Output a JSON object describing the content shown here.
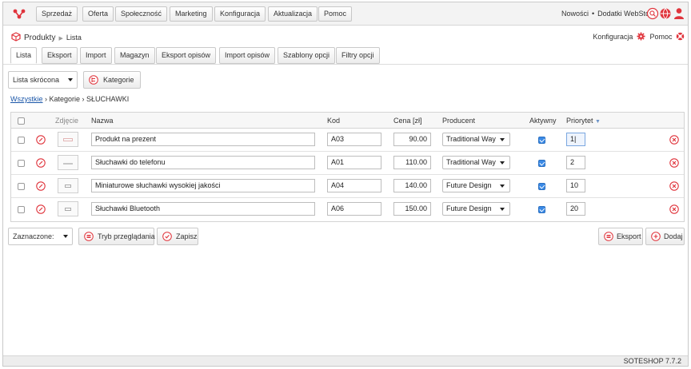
{
  "nav": {
    "buttons": [
      "Sprzedaż",
      "Oferta",
      "Społeczność",
      "Marketing",
      "Konfiguracja",
      "Aktualizacja",
      "Pomoc"
    ],
    "links": [
      "Nowości",
      "Dodatki WebStore"
    ],
    "separator": "•"
  },
  "breadcrumb": {
    "module": "Produkty",
    "page": "Lista"
  },
  "header_actions": {
    "config": "Konfiguracja",
    "help": "Pomoc"
  },
  "tabs": [
    "Lista",
    "Eksport",
    "Import",
    "Magazyn",
    "Eksport opisów",
    "Import opisów",
    "Szablony opcji",
    "Filtry opcji"
  ],
  "view_select": "Lista skrócona",
  "categories_button": "Kategorie",
  "filter": {
    "all_link": "Wszystkie",
    "path": "› Kategorie › SŁUCHAWKI"
  },
  "table": {
    "columns": [
      "Zdjęcie",
      "Nazwa",
      "Kod",
      "Cena [zł]",
      "Producent",
      "Aktywny",
      "Priorytet"
    ],
    "rows": [
      {
        "name": "Produkt na prezent",
        "code": "A03",
        "price": "90.00",
        "producer": "Traditional Way",
        "active": true,
        "priority": "1|"
      },
      {
        "name": "Słuchawki do telefonu",
        "code": "A01",
        "price": "110.00",
        "producer": "Traditional Way",
        "active": true,
        "priority": "2"
      },
      {
        "name": "Miniaturowe słuchawki wysokiej jakości",
        "code": "A04",
        "price": "140.00",
        "producer": "Future Design",
        "active": true,
        "priority": "10"
      },
      {
        "name": "Słuchawki Bluetooth",
        "code": "A06",
        "price": "150.00",
        "producer": "Future Design",
        "active": true,
        "priority": "20"
      }
    ]
  },
  "bulk": {
    "select": "Zaznaczone:",
    "browse_mode": "Tryb przeglądania",
    "save": "Zapisz"
  },
  "actions": {
    "export": "Eksport",
    "add": "Dodaj"
  },
  "footer": "SOTESHOP 7.7.2",
  "colors": {
    "accent": "#e0343c",
    "checkbox": "#3b8ae6",
    "link": "#1a56a8"
  }
}
